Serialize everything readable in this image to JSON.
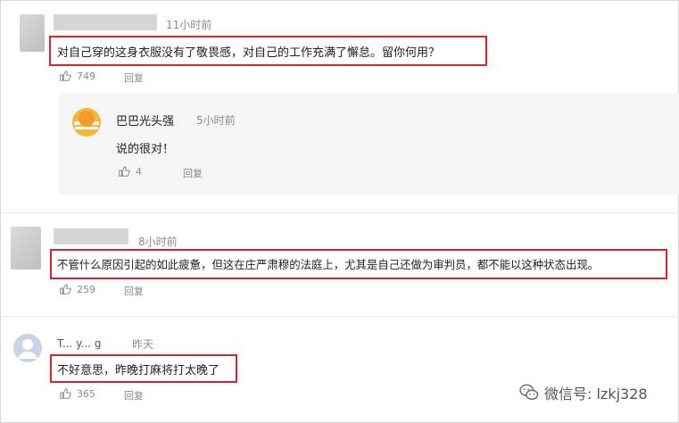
{
  "comments": [
    {
      "time": "11小时前",
      "text": "对自己穿的这身衣服没有了敬畏感，对自己的工作充满了懈怠。留你何用？",
      "likes": "749",
      "reply_label": "回复"
    },
    {
      "time": "8小时前",
      "text": "不管什么原因引起的如此疲惫，但这在庄严肃穆的法庭上，尤其是自己还做为审判员，都不能以这种状态出现。",
      "likes": "259",
      "reply_label": "回复"
    },
    {
      "name": "T... y... g",
      "time": "昨天",
      "text": "不好意思，昨晚打麻将打太晚了",
      "likes": "365",
      "reply_label": "回复"
    }
  ],
  "nested_reply": {
    "name": "巴巴光头强",
    "time": "5小时前",
    "text": "说的很对！",
    "likes": "4",
    "reply_label": "回复"
  },
  "watermark": {
    "text": "微信号: lzkj328"
  },
  "colors": {
    "highlight_box": "#d9232d",
    "muted_text": "#8a8a8a",
    "reply_panel_bg": "#f5f5f5"
  }
}
